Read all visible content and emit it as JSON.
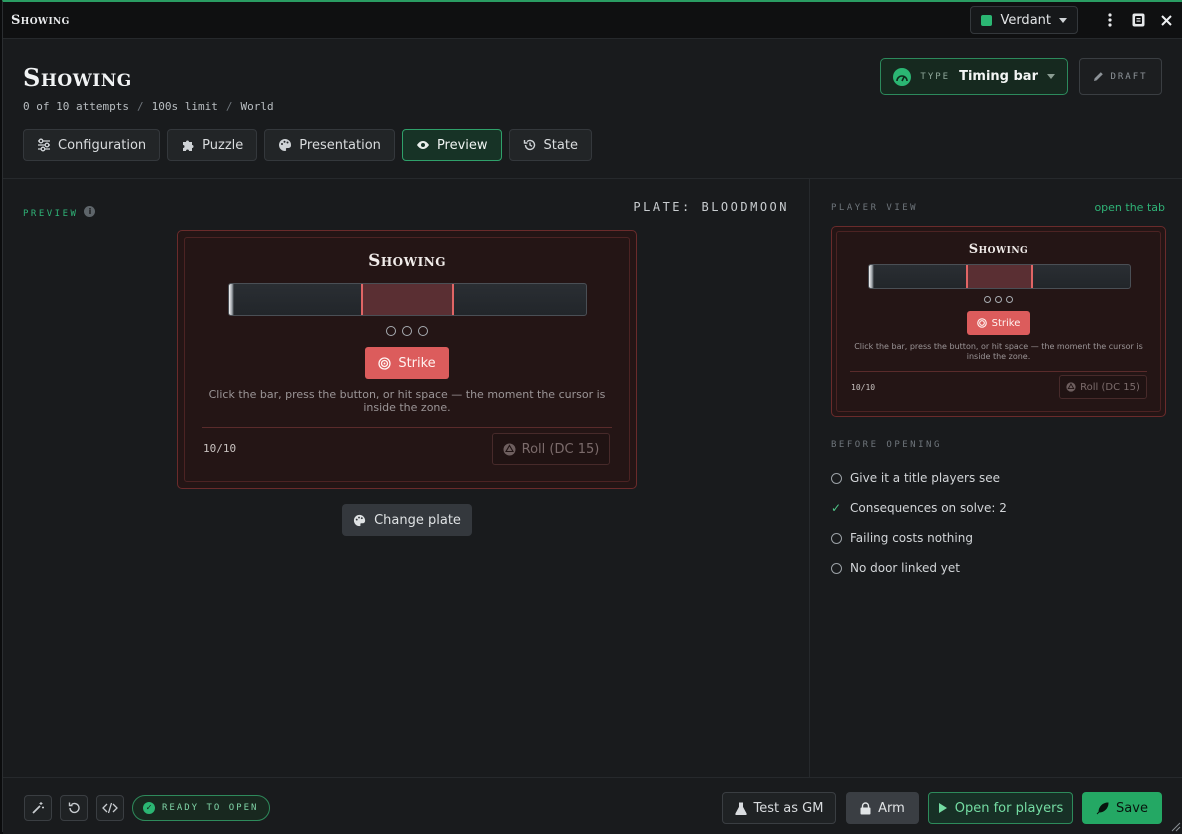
{
  "window": {
    "title": "Showing"
  },
  "theme": {
    "name": "Verdant",
    "color": "#2bb673"
  },
  "header": {
    "title": "Showing",
    "meta": [
      "0 of 10 attempts",
      "100s limit",
      "World"
    ],
    "meta_sep": "/",
    "type_label": "TYPE",
    "type_value": "Timing bar",
    "draft_label": "DRAFT"
  },
  "tabs": [
    {
      "label": "Configuration",
      "icon": "sliders-icon"
    },
    {
      "label": "Puzzle",
      "icon": "puzzle-icon"
    },
    {
      "label": "Presentation",
      "icon": "palette-icon"
    },
    {
      "label": "Preview",
      "icon": "eye-icon",
      "active": true
    },
    {
      "label": "State",
      "icon": "history-icon"
    }
  ],
  "preview": {
    "label": "PREVIEW",
    "plate_label": "PLATE: BLOODMOON",
    "card": {
      "title": "Showing",
      "zone_start": 0.37,
      "zone_end": 0.63,
      "pips": 3,
      "strike_label": "Strike",
      "hint": "Click the bar, press the button, or hit space — the moment the cursor is inside the zone.",
      "counter": "10/10",
      "roll_label": "Roll (DC 15)"
    },
    "change_plate_label": "Change plate"
  },
  "player_view": {
    "label": "PLAYER VIEW",
    "link": "open the tab"
  },
  "before_opening": {
    "label": "BEFORE OPENING",
    "items": [
      {
        "text": "Give it a title players see",
        "done": false
      },
      {
        "text": "Consequences on solve: 2",
        "done": true
      },
      {
        "text": "Failing costs nothing",
        "done": false
      },
      {
        "text": "No door linked yet",
        "done": false
      }
    ]
  },
  "footer": {
    "ready_label": "READY TO OPEN",
    "test_label": "Test as GM",
    "arm_label": "Arm",
    "open_label": "Open for players",
    "save_label": "Save"
  }
}
